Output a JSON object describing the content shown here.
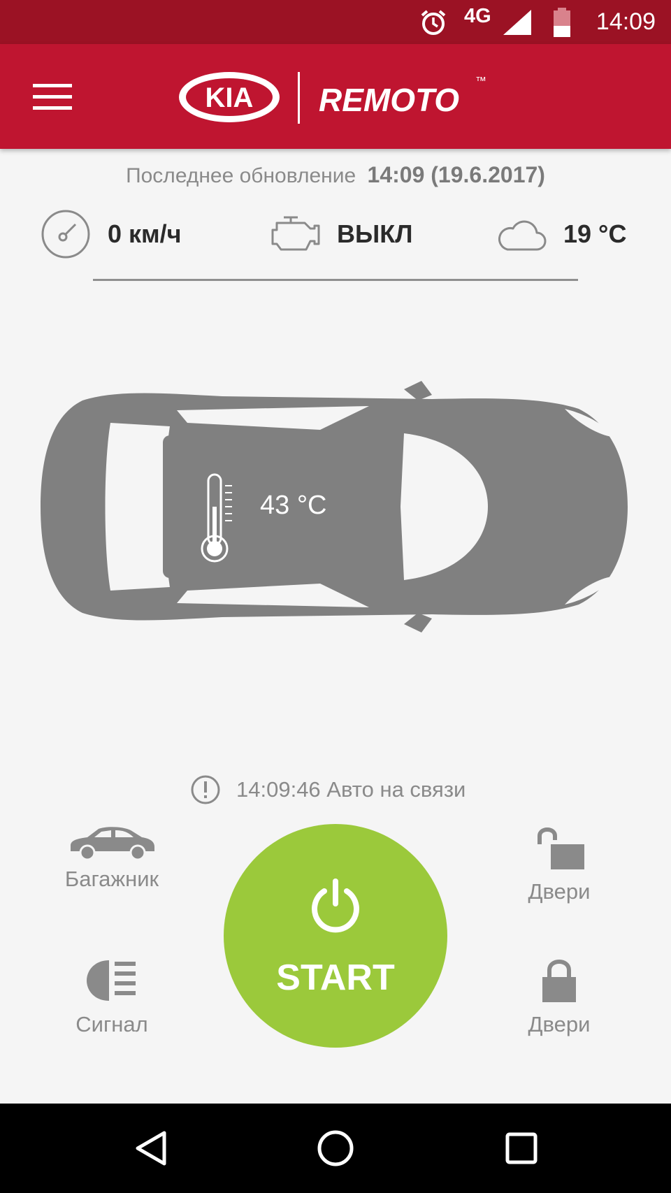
{
  "status_bar": {
    "network": "4G",
    "time": "14:09",
    "icons": [
      "alarm-icon",
      "signal-icon",
      "battery-icon"
    ]
  },
  "app_bar": {
    "brand": "KIA",
    "product": "REMOTO",
    "trademark": "™",
    "menu_icon": "hamburger-menu-icon"
  },
  "last_update": {
    "label": "Последнее обновление",
    "value": "14:09 (19.6.2017)"
  },
  "stats": {
    "speed": {
      "icon": "speedometer-icon",
      "value": "0 км/ч"
    },
    "engine": {
      "icon": "engine-icon",
      "value": "ВЫКЛ"
    },
    "weather": {
      "icon": "cloud-icon",
      "value": "19 °C"
    }
  },
  "car": {
    "cabin_temperature": "43 °C",
    "icon": "thermometer-icon"
  },
  "connection": {
    "icon": "info-icon",
    "text": "14:09:46 Авто на связи"
  },
  "controls": {
    "trunk": {
      "icon": "car-side-icon",
      "label": "Багажник"
    },
    "signal": {
      "icon": "headlight-icon",
      "label": "Сигнал"
    },
    "unlock": {
      "icon": "unlock-icon",
      "label": "Двери"
    },
    "lock": {
      "icon": "lock-icon",
      "label": "Двери"
    },
    "start": {
      "icon": "power-icon",
      "label": "START"
    }
  },
  "colors": {
    "status_bar": "#9b1224",
    "app_bar": "#bf1530",
    "start_button": "#9bc93b",
    "background": "#f5f5f5",
    "car": "#808080"
  },
  "nav_bar": {
    "icons": [
      "back-icon",
      "home-icon",
      "recents-icon"
    ]
  }
}
